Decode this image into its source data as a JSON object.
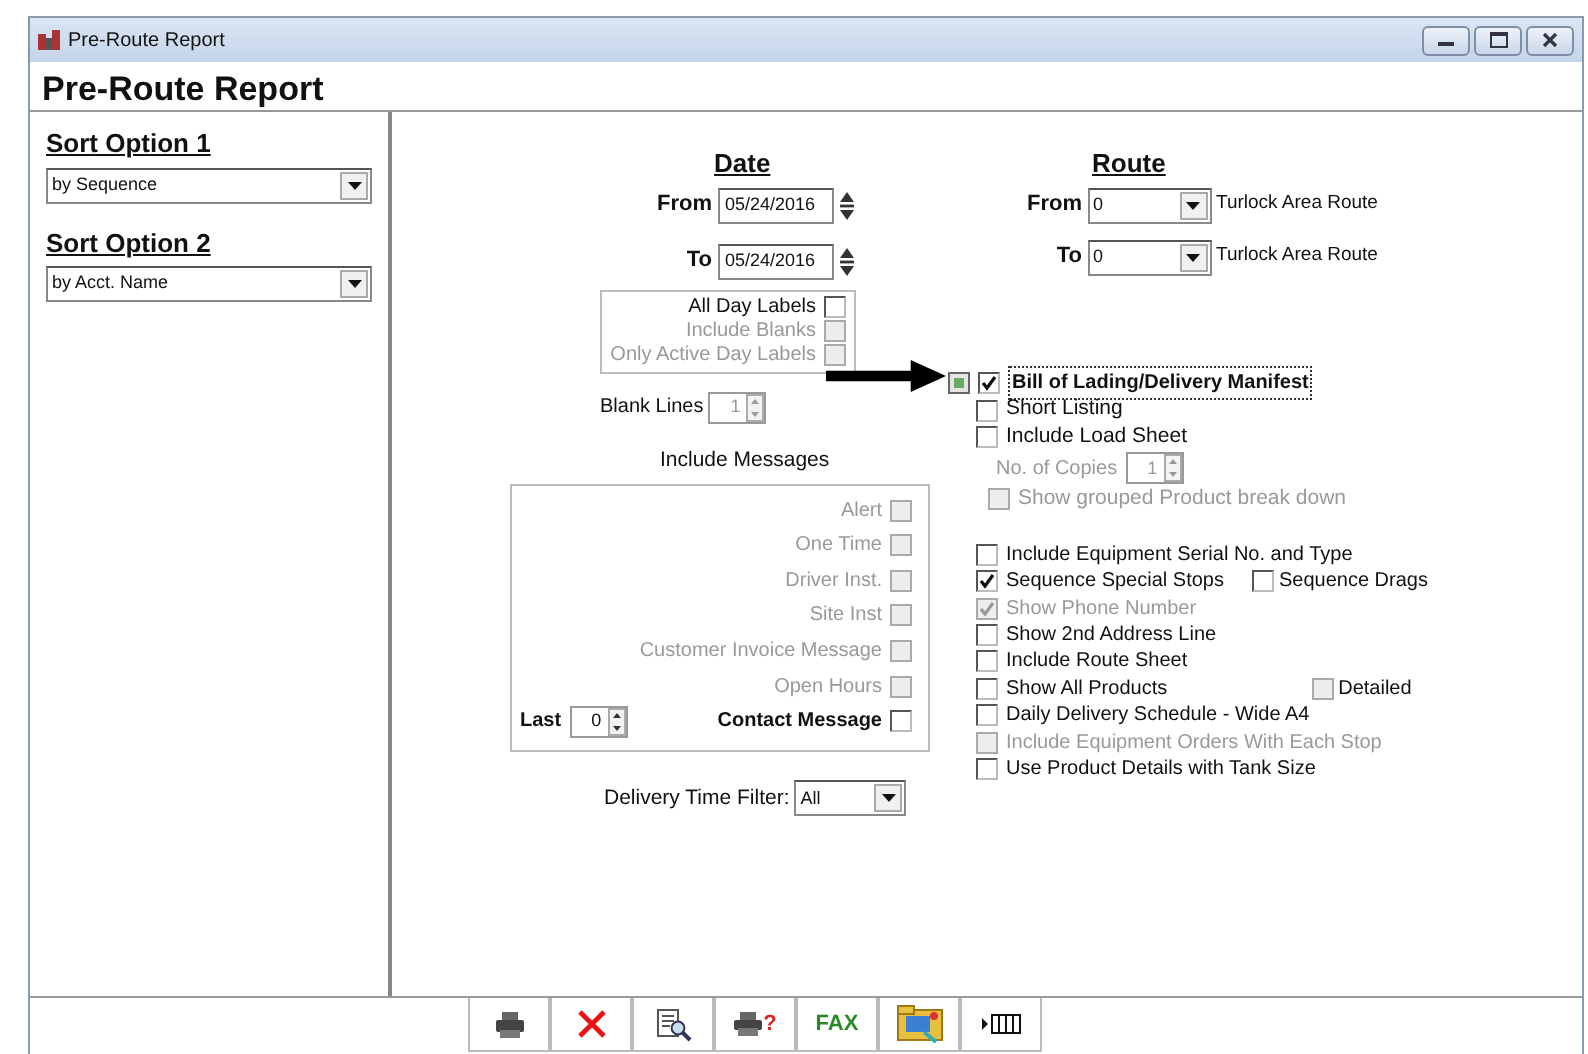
{
  "window": {
    "title": "Pre-Route Report"
  },
  "heading": "Pre-Route Report",
  "sort_options": [
    {
      "label": "Sort Option 1",
      "value": "by Sequence"
    },
    {
      "label": "Sort Option 2",
      "value": "by Acct. Name"
    }
  ],
  "date": {
    "heading": "Date",
    "from": {
      "label": "From",
      "value": "05/24/2016"
    },
    "to": {
      "label": "To",
      "value": "05/24/2016"
    },
    "day_labels": [
      {
        "label": "All Day Labels",
        "checked": false,
        "disabled": false
      },
      {
        "label": "Include Blanks",
        "checked": false,
        "disabled": true
      },
      {
        "label": "Only Active Day Labels",
        "checked": false,
        "disabled": true
      }
    ]
  },
  "blank_lines": {
    "label": "Blank Lines",
    "value": "1",
    "disabled": true
  },
  "include_messages": {
    "heading": "Include Messages",
    "items": [
      {
        "label": "Alert",
        "checked": false,
        "disabled": true
      },
      {
        "label": "One Time",
        "checked": false,
        "disabled": true
      },
      {
        "label": "Driver Inst.",
        "checked": false,
        "disabled": true
      },
      {
        "label": "Site Inst",
        "checked": false,
        "disabled": true
      },
      {
        "label": "Customer Invoice Message",
        "checked": false,
        "disabled": true
      },
      {
        "label": "Open Hours",
        "checked": false,
        "disabled": true
      },
      {
        "label": "Contact Message",
        "checked": false,
        "disabled": false
      }
    ],
    "last": {
      "label": "Last",
      "value": "0"
    }
  },
  "delivery_time_filter": {
    "label": "Delivery Time Filter:",
    "value": "All"
  },
  "route": {
    "heading": "Route",
    "from": {
      "label": "From",
      "value": "0",
      "name": "Turlock Area Route"
    },
    "to": {
      "label": "To",
      "value": "0",
      "name": "Turlock Area Route"
    }
  },
  "report": {
    "label": "Bill of Lading/Delivery Manifest",
    "checked": true,
    "focused": true,
    "children": [
      {
        "kind": "checkbox",
        "label": "Short Listing",
        "checked": false,
        "disabled": false
      },
      {
        "kind": "checkbox",
        "label": "Include Load Sheet",
        "checked": false,
        "disabled": false,
        "children": [
          {
            "kind": "spinner",
            "label": "No. of Copies",
            "value": "1",
            "disabled": true
          },
          {
            "kind": "checkbox",
            "label": "Show grouped Product break down",
            "checked": false,
            "disabled": true
          }
        ]
      }
    ]
  },
  "options": [
    {
      "label": "Include Equipment Serial No. and Type",
      "checked": false,
      "disabled": false
    },
    {
      "label": "Sequence Special Stops",
      "checked": true,
      "disabled": false,
      "extra": {
        "label": "Sequence Drags",
        "checked": false,
        "disabled": false
      }
    },
    {
      "label": "Show Phone Number",
      "checked": true,
      "disabled": true
    },
    {
      "label": "Show 2nd Address Line",
      "checked": false,
      "disabled": false
    },
    {
      "label": "Include Route Sheet",
      "checked": false,
      "disabled": false
    },
    {
      "label": "Show All Products",
      "checked": false,
      "disabled": false,
      "extra": {
        "label": "Detailed",
        "checked": false,
        "disabled": true
      }
    },
    {
      "label": "Daily  Delivery Schedule - Wide  A4",
      "checked": false,
      "disabled": false
    },
    {
      "label": "Include Equipment Orders With Each Stop",
      "checked": false,
      "disabled": true
    },
    {
      "label": "Use Product Details with Tank Size",
      "checked": false,
      "disabled": false
    }
  ],
  "toolbar": [
    {
      "kind": "print"
    },
    {
      "kind": "close"
    },
    {
      "kind": "preview"
    },
    {
      "kind": "print-help",
      "text": "?"
    },
    {
      "kind": "fax",
      "text": "FAX"
    },
    {
      "kind": "transfer"
    },
    {
      "kind": "columns"
    }
  ]
}
